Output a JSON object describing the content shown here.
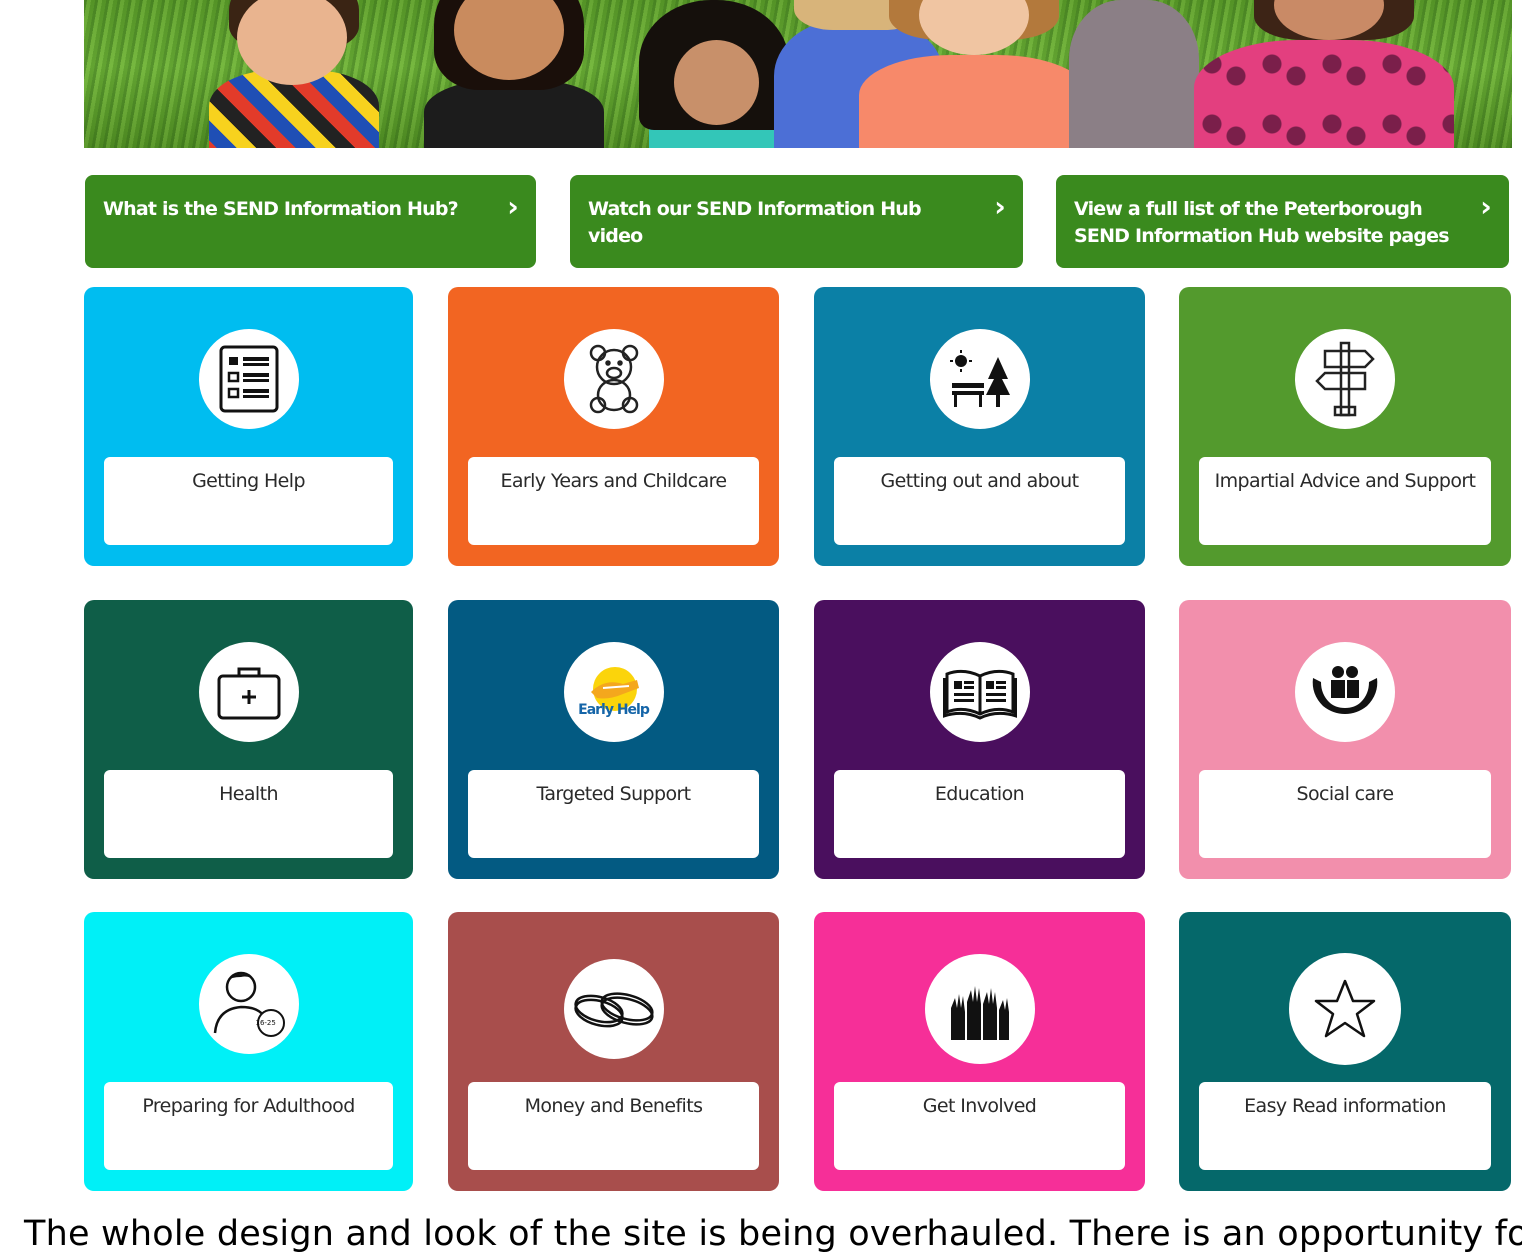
{
  "hero": {
    "image_desc": "children-lying-on-grass-photo"
  },
  "links": [
    {
      "label": "What is the SEND Information Hub?",
      "icon": "chevron-right-icon"
    },
    {
      "label": "Watch our SEND Information Hub video",
      "icon": "chevron-right-icon"
    },
    {
      "label": "View a full list of the Peterborough SEND Information Hub website pages",
      "icon": "chevron-right-icon"
    }
  ],
  "tiles": [
    {
      "label": "Getting Help",
      "color": "#00bdf0",
      "icon": "checklist-icon"
    },
    {
      "label": "Early Years and Childcare",
      "color": "#f26522",
      "icon": "teddy-bear-icon"
    },
    {
      "label": "Getting out and about",
      "color": "#0b80a6",
      "icon": "park-bench-icon"
    },
    {
      "label": "Impartial Advice and Support",
      "color": "#539a2d",
      "icon": "signpost-icon"
    },
    {
      "label": "Health",
      "color": "#0f5e48",
      "icon": "medical-bag-icon"
    },
    {
      "label": "Targeted Support",
      "color": "#035a82",
      "icon": "early-help-logo-icon",
      "icon_text": "Early Help"
    },
    {
      "label": "Education",
      "color": "#4a0f5e",
      "icon": "open-book-icon"
    },
    {
      "label": "Social care",
      "color": "#f28fac",
      "icon": "hands-family-icon"
    },
    {
      "label": "Preparing for Adulthood",
      "color": "#00f0f7",
      "icon": "person-age-icon",
      "icon_text": "16-25"
    },
    {
      "label": "Money and Benefits",
      "color": "#a84e4c",
      "icon": "coins-icon"
    },
    {
      "label": "Get Involved",
      "color": "#f62f98",
      "icon": "raised-hands-icon"
    },
    {
      "label": "Easy Read information",
      "color": "#05686a",
      "icon": "star-icon"
    }
  ],
  "footer": {
    "text": "The whole design and look of the site is being overhauled. There is an opportunity for"
  }
}
